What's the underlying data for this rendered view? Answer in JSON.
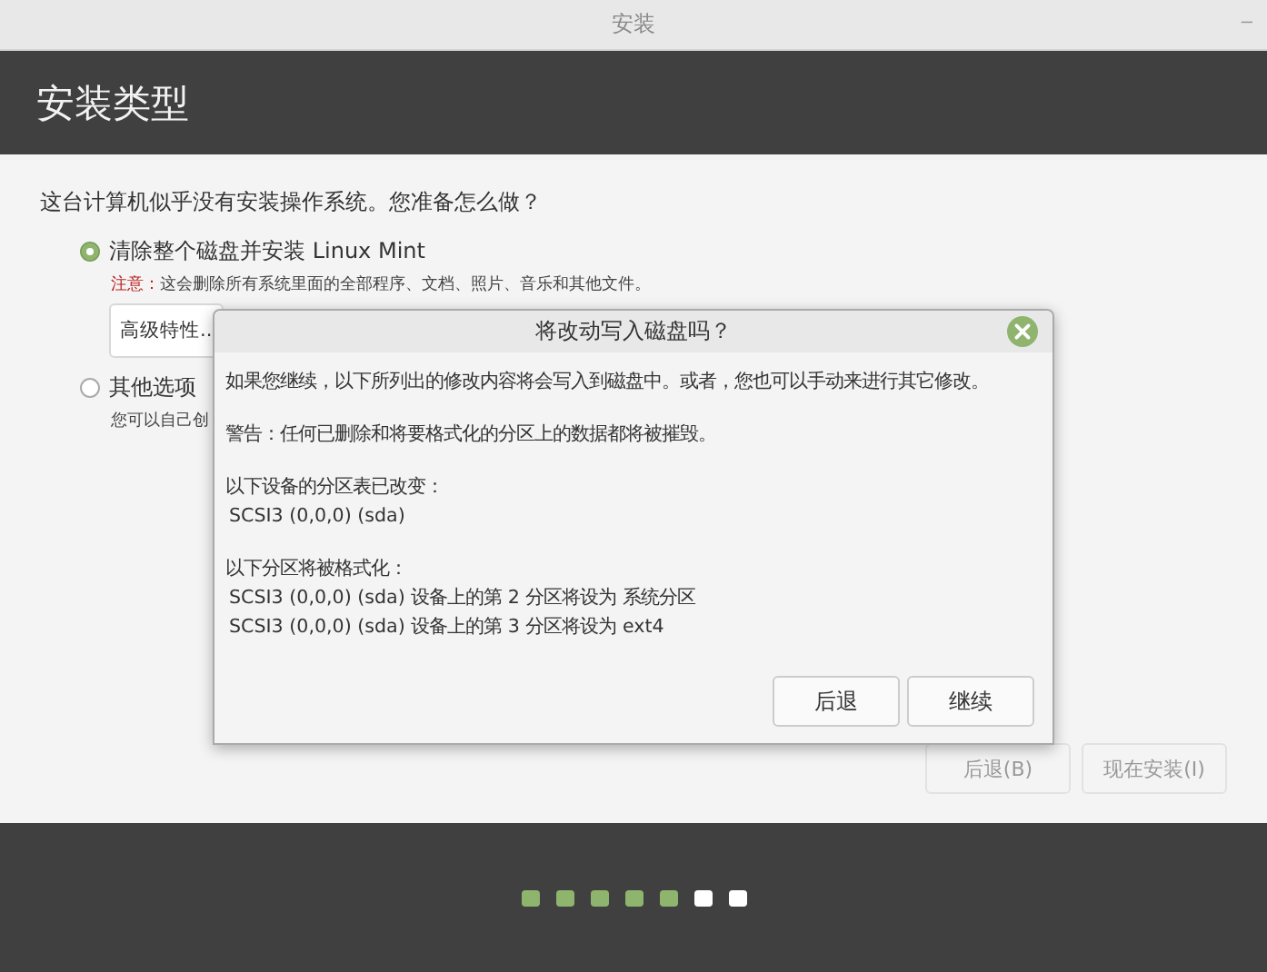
{
  "window": {
    "title": "安装",
    "minimize": "–"
  },
  "header": {
    "title": "安装类型"
  },
  "content": {
    "question": "这台计算机似乎没有安装操作系统。您准备怎么做？",
    "options": [
      {
        "label": "清除整个磁盘并安装 Linux Mint",
        "selected": true,
        "note_label": "注意：",
        "note": "这会删除所有系统里面的全部程序、文档、照片、音乐和其他文件。",
        "button": "高级特性.."
      },
      {
        "label": "其他选项",
        "selected": false,
        "note": "您可以自己创"
      }
    ],
    "buttons": [
      {
        "label": "后退(B)",
        "disabled": true
      },
      {
        "label": "现在安装(I)",
        "disabled": true
      }
    ]
  },
  "progress": [
    {
      "done": true
    },
    {
      "done": true
    },
    {
      "done": true
    },
    {
      "done": true
    },
    {
      "done": true
    },
    {
      "done": false
    },
    {
      "done": false
    }
  ],
  "dialog": {
    "title": "将改动写入磁盘吗？",
    "paragraphs": [
      {
        "lines": [
          "如果您继续，以下所列出的修改内容将会写入到磁盘中。或者，您也可以手动来进行其它修改。"
        ]
      },
      {
        "lines": [
          "警告：任何已删除和将要格式化的分区上的数据都将被摧毁。"
        ]
      },
      {
        "lines": [
          "以下设备的分区表已改变：",
          "SCSI3 (0,0,0) (sda)"
        ]
      },
      {
        "lines": [
          "以下分区将被格式化：",
          "SCSI3 (0,0,0) (sda) 设备上的第 2 分区将设为 系统分区",
          "SCSI3 (0,0,0) (sda) 设备上的第 3 分区将设为 ext4"
        ]
      }
    ],
    "buttons": [
      "后退",
      "继续"
    ]
  }
}
